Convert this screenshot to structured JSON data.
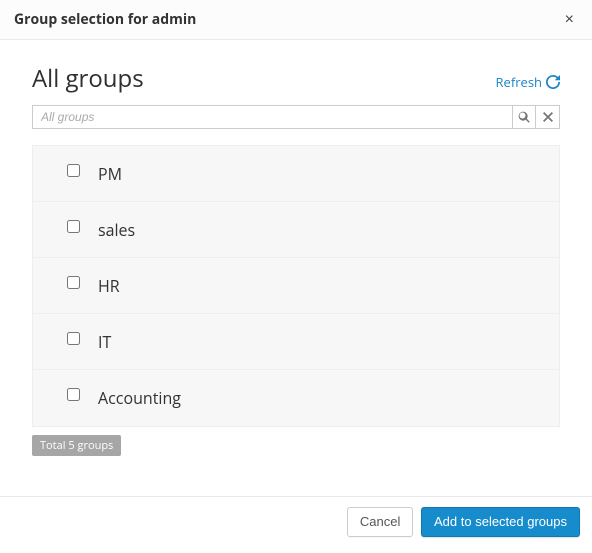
{
  "header": {
    "title": "Group selection for admin"
  },
  "main": {
    "heading": "All groups",
    "refresh_label": "Refresh",
    "search_placeholder": "All groups",
    "groups": [
      {
        "name": "PM"
      },
      {
        "name": "sales"
      },
      {
        "name": "HR"
      },
      {
        "name": "IT"
      },
      {
        "name": "Accounting"
      }
    ],
    "total_label": "Total 5 groups"
  },
  "footer": {
    "cancel_label": "Cancel",
    "add_label": "Add to selected groups"
  }
}
